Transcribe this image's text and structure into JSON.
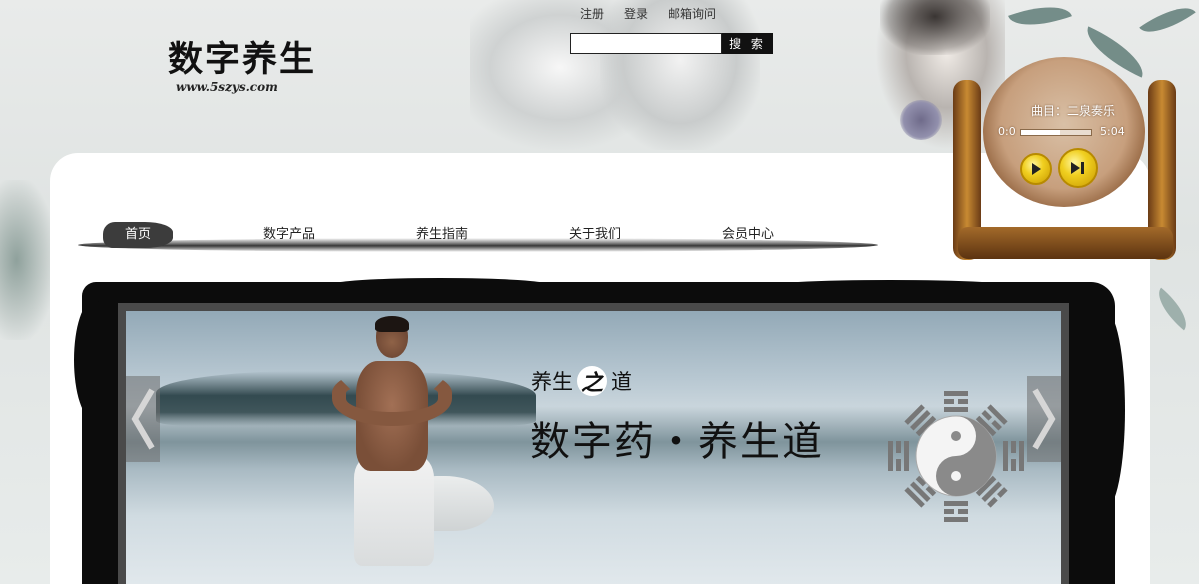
{
  "colors": {
    "accent": "#111111",
    "nav_active": "#3c3c3c",
    "player_gold": "#f0cf20"
  },
  "top_links": [
    {
      "label": "注册"
    },
    {
      "label": "登录"
    },
    {
      "label": "邮箱询问"
    }
  ],
  "search": {
    "value": "",
    "placeholder": "",
    "button_label": "搜 索"
  },
  "logo": {
    "title": "数字养生",
    "url_text": "www.5szys.com"
  },
  "nav": {
    "items": [
      {
        "label": "首页",
        "active": true
      },
      {
        "label": "数字产品",
        "active": false
      },
      {
        "label": "养生指南",
        "active": false
      },
      {
        "label": "关于我们",
        "active": false
      },
      {
        "label": "会员中心",
        "active": false
      }
    ]
  },
  "player": {
    "song_label": "曲目：二泉奏乐",
    "current_time": "0:0",
    "total_time": "5:04",
    "progress": 0.55,
    "icons": {
      "play": "play-icon",
      "next": "next-track-icon"
    }
  },
  "banner": {
    "slogan_small_left": "养生",
    "slogan_small_zhi": "之",
    "slogan_small_right": "道",
    "slogan_big": "数字药・养生道",
    "icons": {
      "prev": "chevron-left-icon",
      "next": "chevron-right-icon",
      "emblem": "bagua-yinyang-icon"
    }
  }
}
